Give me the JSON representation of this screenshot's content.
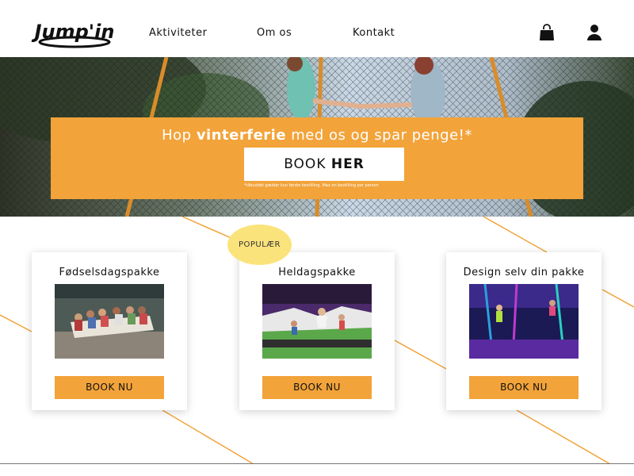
{
  "header": {
    "logo_text": "Jump'in",
    "nav": [
      "Aktiviteter",
      "Om os",
      "Kontakt"
    ],
    "cart_icon": "shopping-bag-icon",
    "user_icon": "user-icon"
  },
  "hero": {
    "headline_pre": "Hop ",
    "headline_bold": "vinterferie",
    "headline_post": " med os og spar penge!*",
    "cta_pre": "BOOK ",
    "cta_bold": "HER",
    "disclaimer": "*tilbuddet gælder kun første bestilling. Max en bestilling per person"
  },
  "badge": "POPULÆR",
  "cards": [
    {
      "title": "Fødselsdagspakke",
      "button": "BOOK NU"
    },
    {
      "title": "Heldagspakke",
      "button": "BOOK NU"
    },
    {
      "title": "Design selv din pakke",
      "button": "BOOK NU"
    }
  ],
  "colors": {
    "accent": "#f2a33a",
    "badge": "#fbe37c",
    "text": "#111111"
  }
}
